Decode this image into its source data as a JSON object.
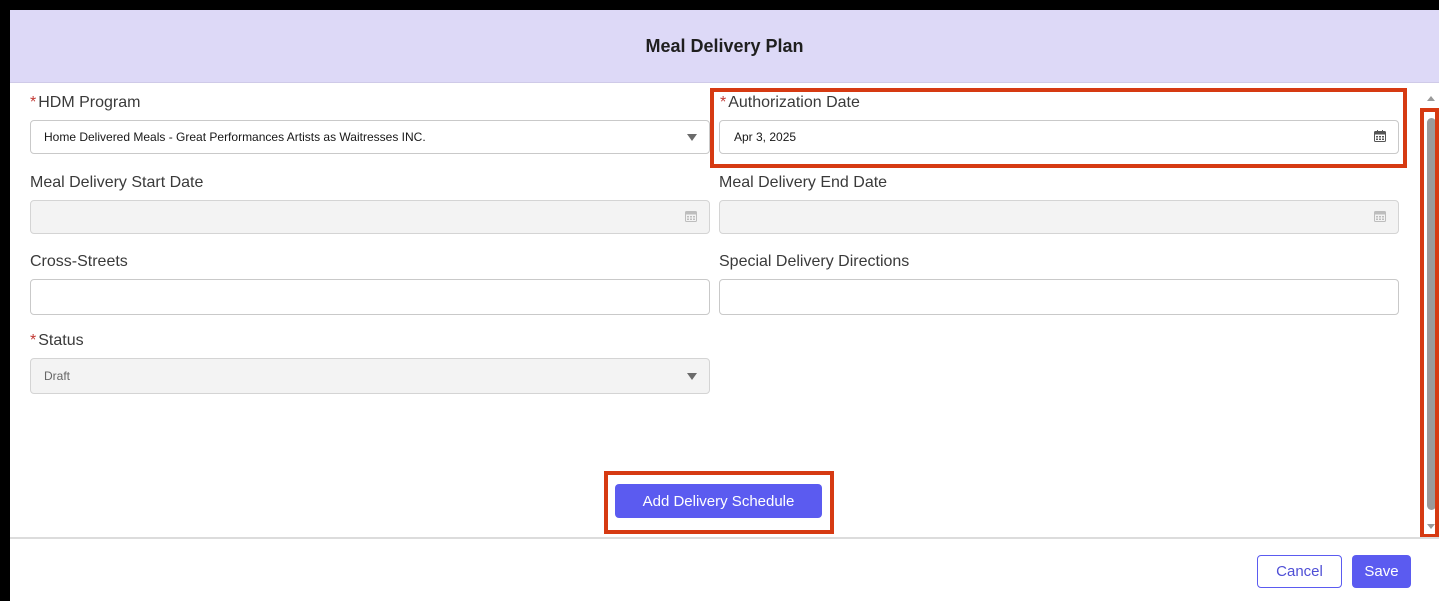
{
  "modal": {
    "title": "Meal Delivery Plan"
  },
  "fields": {
    "hdm_program": {
      "label": "HDM Program",
      "required": "*",
      "value": "Home Delivered Meals - Great Performances Artists as Waitresses INC."
    },
    "authorization_date": {
      "label": "Authorization Date",
      "required": "*",
      "value": "Apr 3, 2025"
    },
    "start_date": {
      "label": "Meal Delivery Start Date",
      "value": ""
    },
    "end_date": {
      "label": "Meal Delivery End Date",
      "value": ""
    },
    "cross_streets": {
      "label": "Cross-Streets",
      "value": ""
    },
    "special_directions": {
      "label": "Special Delivery Directions",
      "value": ""
    },
    "status": {
      "label": "Status",
      "required": "*",
      "value": "Draft"
    }
  },
  "buttons": {
    "add_schedule": "Add Delivery Schedule",
    "cancel": "Cancel",
    "save": "Save"
  },
  "icons": {
    "dropdown": "chevron-down-icon",
    "calendar": "calendar-icon"
  },
  "colors": {
    "header_bg": "#ddd9f7",
    "primary": "#5b5bf0",
    "required": "#c23934",
    "highlight": "#d63a12"
  }
}
